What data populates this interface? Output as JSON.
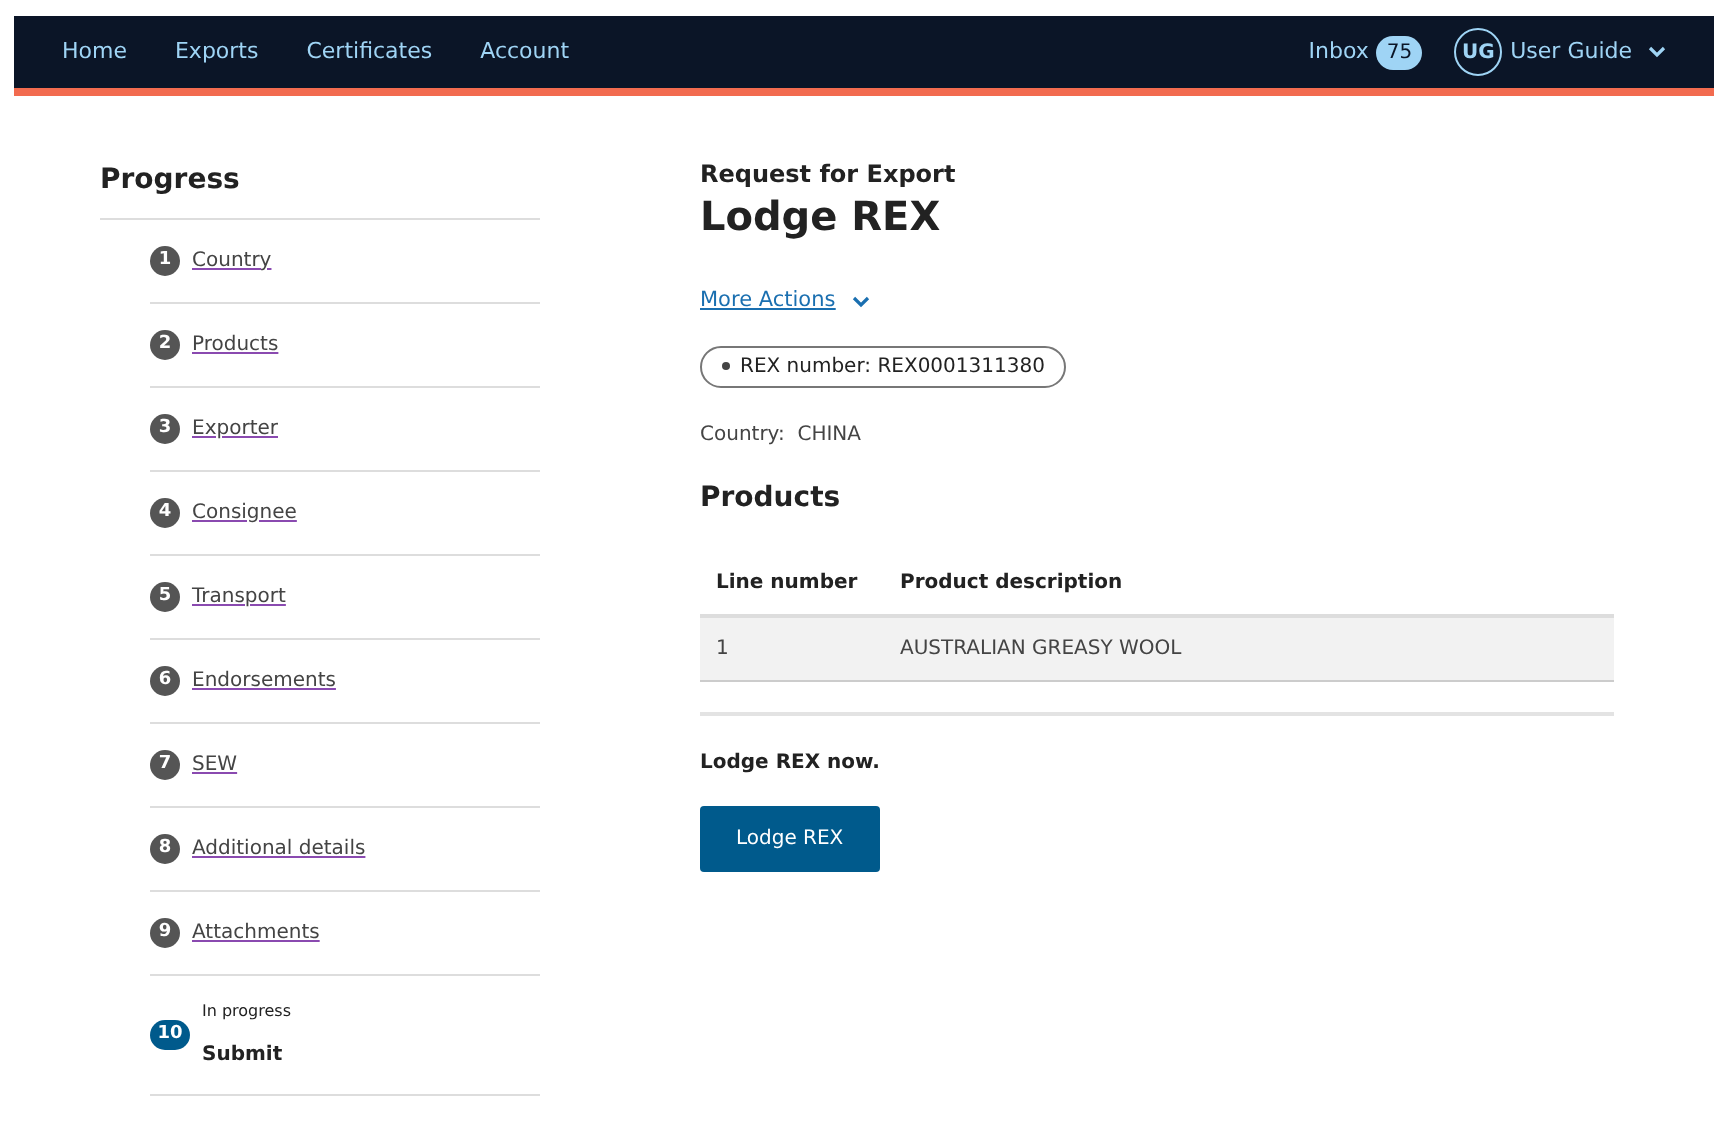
{
  "nav": {
    "links": [
      "Home",
      "Exports",
      "Certificates",
      "Account"
    ],
    "inbox": {
      "label": "Inbox",
      "count": "75"
    },
    "user": {
      "initials": "UG",
      "name": "User Guide"
    }
  },
  "progress": {
    "title": "Progress",
    "steps": [
      {
        "number": "1",
        "label": "Country",
        "kind": "done"
      },
      {
        "number": "2",
        "label": "Products",
        "kind": "done"
      },
      {
        "number": "3",
        "label": "Exporter",
        "kind": "done"
      },
      {
        "number": "4",
        "label": "Consignee",
        "kind": "done"
      },
      {
        "number": "5",
        "label": "Transport",
        "kind": "done"
      },
      {
        "number": "6",
        "label": "Endorsements",
        "kind": "done"
      },
      {
        "number": "7",
        "label": "SEW",
        "kind": "done"
      },
      {
        "number": "8",
        "label": "Additional details",
        "kind": "done"
      },
      {
        "number": "9",
        "label": "Attachments",
        "kind": "done"
      },
      {
        "number": "10",
        "label": "Submit",
        "kind": "current",
        "status": "In progress"
      }
    ]
  },
  "main": {
    "subtitle": "Request for Export",
    "title": "Lodge REX",
    "more_actions": "More Actions",
    "tag": "REX number: REX0001311380",
    "country": "Country:  CHINA",
    "products_title": "Products",
    "table": {
      "columns": [
        "Line number",
        "Product description"
      ],
      "rows": [
        [
          "1",
          "AUSTRALIAN GREASY WOOL"
        ]
      ]
    },
    "prompt": "Lodge REX now.",
    "button": "Lodge REX"
  }
}
